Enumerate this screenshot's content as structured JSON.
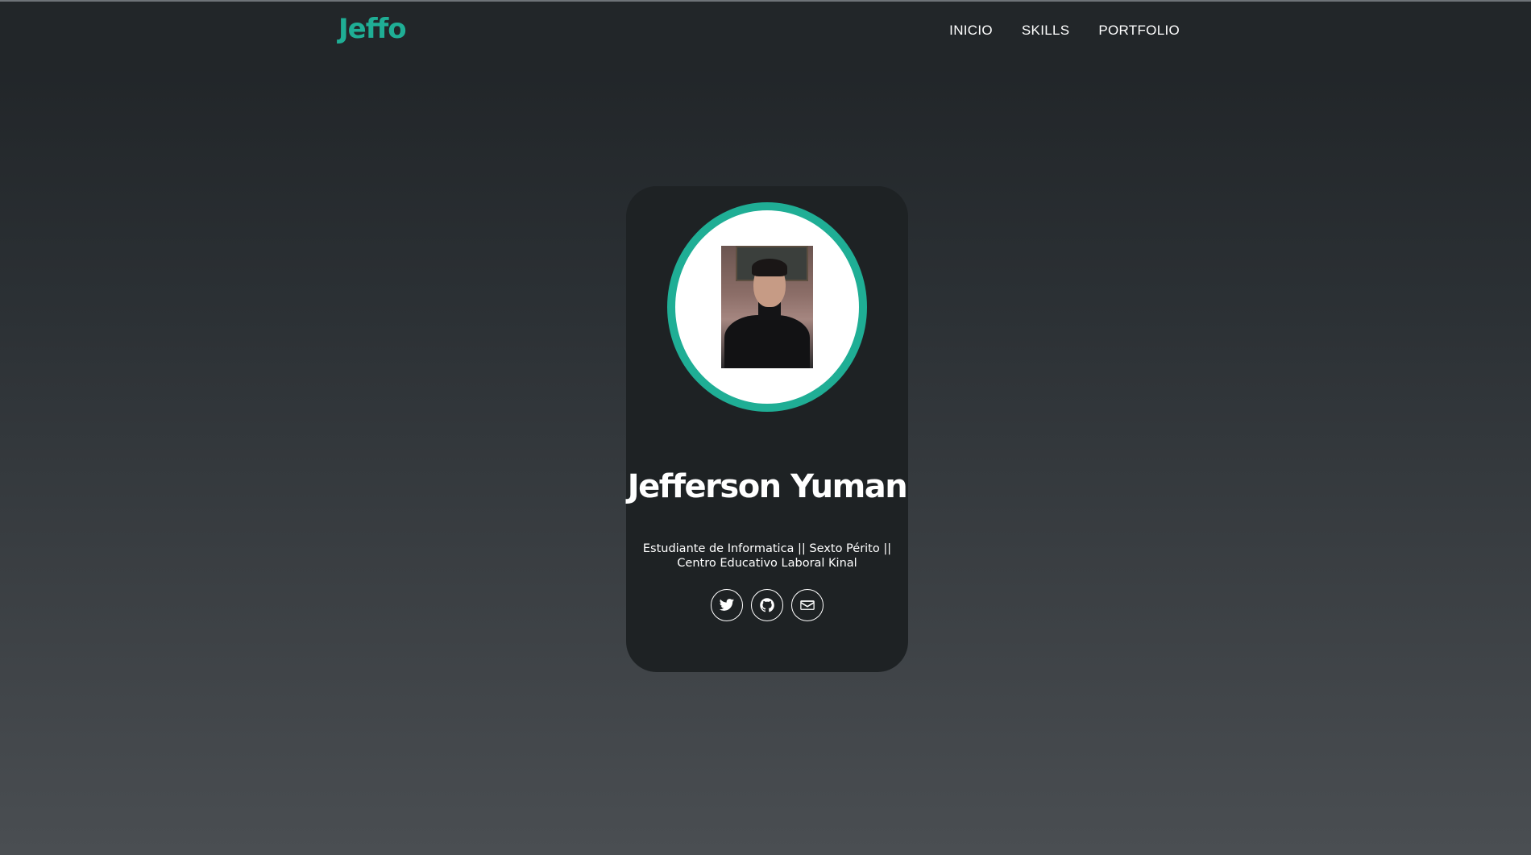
{
  "navbar": {
    "brand": "Jeffo",
    "links": [
      {
        "label": "INICIO"
      },
      {
        "label": "SKILLS"
      },
      {
        "label": "PORTFOLIO"
      }
    ]
  },
  "profile": {
    "name": "Jefferson Yuman",
    "bio": "Estudiante de Informatica || Sexto Périto || Centro Educativo Laboral Kinal",
    "photo_alt": "profile-photo"
  },
  "socials": [
    {
      "icon": "twitter-icon"
    },
    {
      "icon": "github-icon"
    },
    {
      "icon": "envelope-icon"
    }
  ],
  "colors": {
    "accent": "#1fae95",
    "navbar_bg": "#222629",
    "card_bg": "#1e2224",
    "text": "#ffffff"
  }
}
